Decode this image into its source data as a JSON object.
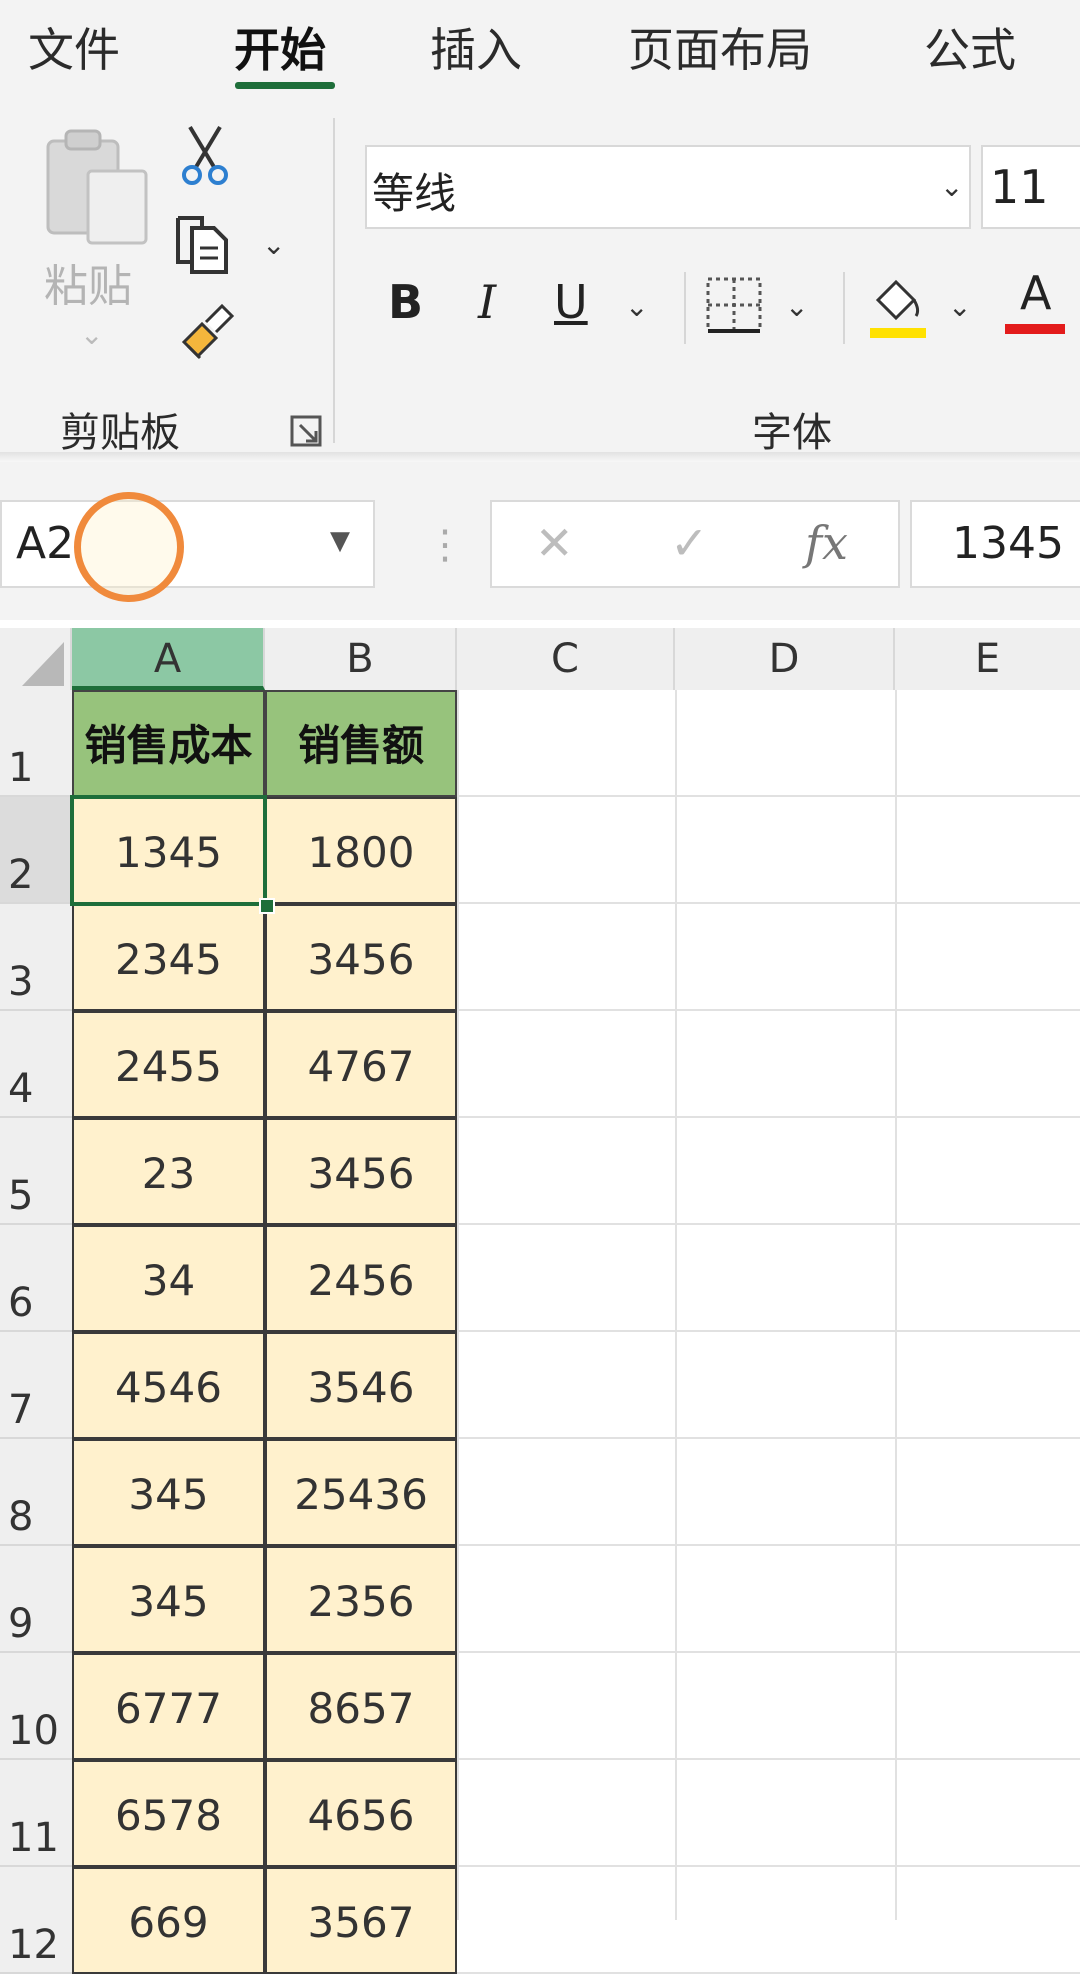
{
  "ribbon": {
    "tabs": [
      "文件",
      "开始",
      "插入",
      "页面布局",
      "公式"
    ],
    "active_tab_index": 1,
    "clipboard": {
      "paste_label": "粘贴",
      "group_label": "剪贴板"
    },
    "font": {
      "font_name": "等线",
      "font_size": "11",
      "bold": "B",
      "italic": "I",
      "underline": "U",
      "font_color_letter": "A",
      "group_label": "字体"
    },
    "colors": {
      "accent": "#1e6e3a",
      "font_color_bar": "#e31b1b",
      "fill_color_bar": "#ffe100"
    }
  },
  "formula_bar": {
    "name_box": "A2",
    "fx_label": "fx",
    "value": "1345"
  },
  "sheet": {
    "columns": [
      "A",
      "B",
      "C",
      "D",
      "E"
    ],
    "headers": [
      "销售成本",
      "销售额"
    ],
    "rows": [
      {
        "num": "1",
        "a": "销售成本",
        "b": "销售额"
      },
      {
        "num": "2",
        "a": "1345",
        "b": "1800"
      },
      {
        "num": "3",
        "a": "2345",
        "b": "3456"
      },
      {
        "num": "4",
        "a": "2455",
        "b": "4767"
      },
      {
        "num": "5",
        "a": "23",
        "b": "3456"
      },
      {
        "num": "6",
        "a": "34",
        "b": "2456"
      },
      {
        "num": "7",
        "a": "4546",
        "b": "3546"
      },
      {
        "num": "8",
        "a": "345",
        "b": "25436"
      },
      {
        "num": "9",
        "a": "345",
        "b": "2356"
      },
      {
        "num": "10",
        "a": "6777",
        "b": "8657"
      },
      {
        "num": "11",
        "a": "6578",
        "b": "4656"
      },
      {
        "num": "12",
        "a": "669",
        "b": "3567"
      }
    ],
    "selected_cell": "A2",
    "header_fill": "#97c37c",
    "data_fill": "#fff1cd"
  }
}
